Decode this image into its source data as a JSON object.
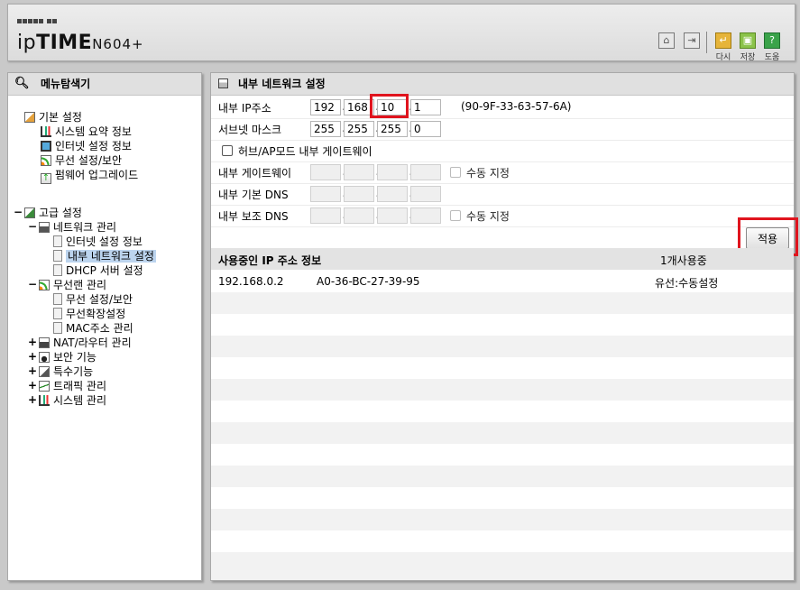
{
  "header": {
    "brand_prefix": "ip",
    "brand_main": "TIME",
    "brand_model": "N604+",
    "buttons": [
      {
        "icon": "home-icon",
        "label": ""
      },
      {
        "icon": "logout-icon",
        "label": ""
      },
      {
        "icon": "refresh-icon",
        "label": "다시"
      },
      {
        "icon": "save-icon",
        "label": "저장"
      },
      {
        "icon": "help-icon",
        "label": "도움"
      }
    ]
  },
  "sidebar": {
    "title": "메뉴탐색기",
    "basic": {
      "label": "기본 설정",
      "items": [
        "시스템 요약 정보",
        "인터넷 설정 정보",
        "무선 설정/보안",
        "펌웨어 업그레이드"
      ]
    },
    "advanced": {
      "expander": "−",
      "label": "고급 설정",
      "network": {
        "expander": "−",
        "label": "네트워크 관리",
        "items": [
          "인터넷 설정 정보",
          "내부 네트워크 설정",
          "DHCP 서버 설정"
        ]
      },
      "wireless": {
        "expander": "−",
        "label": "무선랜 관리",
        "items": [
          "무선 설정/보안",
          "무선확장설정",
          "MAC주소 관리"
        ]
      },
      "others": [
        {
          "expander": "+",
          "label": "NAT/라우터 관리"
        },
        {
          "expander": "+",
          "label": "보안 기능"
        },
        {
          "expander": "+",
          "label": "특수기능"
        },
        {
          "expander": "+",
          "label": "트래픽 관리"
        },
        {
          "expander": "+",
          "label": "시스템 관리"
        }
      ]
    }
  },
  "main": {
    "title": "내부 네트워크 설정",
    "internal_ip": {
      "label": "내부 IP주소",
      "octets": [
        "192",
        "168",
        "10",
        "1"
      ],
      "mac": "(90-9F-33-63-57-6A)"
    },
    "subnet": {
      "label": "서브넷 마스크",
      "octets": [
        "255",
        "255",
        "255",
        "0"
      ]
    },
    "hub_ap": {
      "label": "허브/AP모드 내부 게이트웨이",
      "checked": false
    },
    "gateway": {
      "label": "내부 게이트웨이",
      "manual": "수동 지정"
    },
    "primary_dns": {
      "label": "내부 기본 DNS"
    },
    "secondary_dns": {
      "label": "내부 보조 DNS",
      "manual": "수동 지정"
    },
    "apply_label": "적용",
    "ip_info": {
      "title": "사용중인 IP 주소 정보",
      "count": "1개사용중",
      "rows": [
        {
          "ip": "192.168.0.2",
          "mac": "A0-36-BC-27-39-95",
          "type": "유선:수동설정"
        }
      ]
    }
  }
}
